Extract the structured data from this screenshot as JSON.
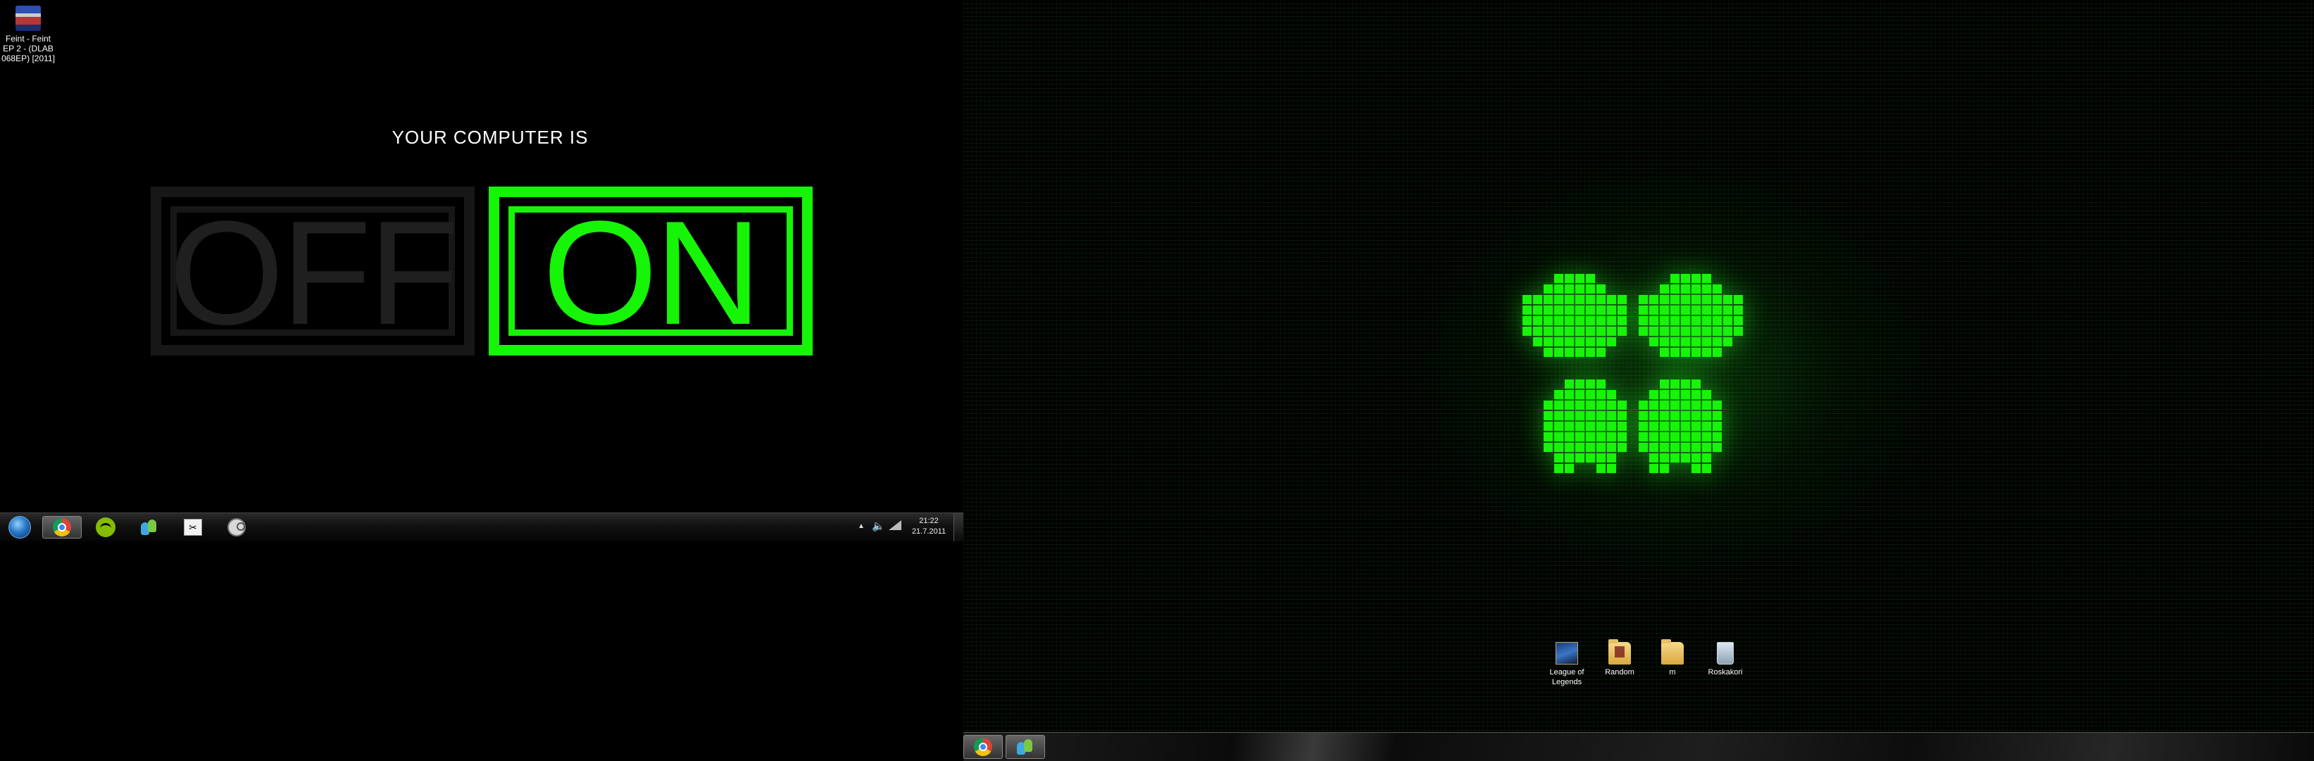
{
  "left_monitor": {
    "desktop_icons": [
      {
        "label": "Feint - Feint EP 2 - (DLAB 068EP) [2011]",
        "icon": "winrar-archive-icon"
      }
    ],
    "wallpaper": {
      "headline": "YOUR COMPUTER IS",
      "off_label": "OFF",
      "on_label": "ON",
      "off_color": "#171717",
      "on_color": "#16f407"
    },
    "taskbar": {
      "pinned": [
        {
          "name": "start-button",
          "icon": "windows-orb-icon"
        },
        {
          "name": "google-chrome",
          "icon": "chrome-icon",
          "active": true
        },
        {
          "name": "spotify",
          "icon": "spotify-icon"
        },
        {
          "name": "windows-live-messenger",
          "icon": "messenger-icon"
        },
        {
          "name": "app",
          "icon": "app-window-icon"
        },
        {
          "name": "steam",
          "icon": "steam-icon"
        }
      ],
      "tray_icons": [
        "show-hidden-icons-arrow",
        "volume-icon",
        "network-signal-icon"
      ],
      "clock_time": "21:22",
      "clock_date": "21.7.2011"
    }
  },
  "right_monitor": {
    "wallpaper": {
      "logo": "windows-logo-icon",
      "accent": "#16f407"
    },
    "desktop_icons": [
      {
        "label": "League of Legends",
        "icon": "league-of-legends-icon"
      },
      {
        "label": "Random",
        "icon": "folder-icon"
      },
      {
        "label": "m",
        "icon": "folder-icon"
      },
      {
        "label": "Roskakori",
        "icon": "recycle-bin-icon"
      }
    ],
    "taskbar": {
      "pinned": [
        {
          "name": "google-chrome",
          "icon": "chrome-icon",
          "active": true
        },
        {
          "name": "windows-live-messenger",
          "icon": "messenger-icon",
          "active": true
        }
      ]
    }
  }
}
